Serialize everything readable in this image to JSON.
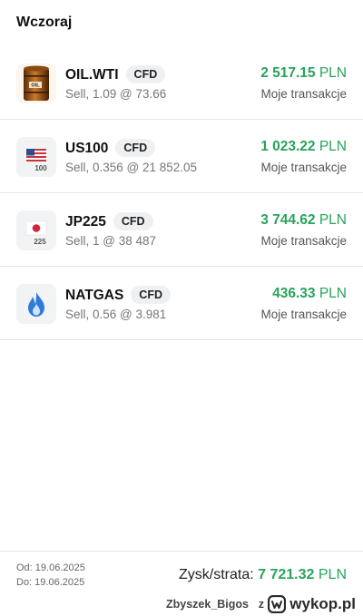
{
  "section": {
    "title": "Wczoraj"
  },
  "positions": [
    {
      "symbol": "OIL.WTI",
      "type": "CFD",
      "detail": "Sell, 1.09 @ 73.66",
      "profit_value": "2 517.15",
      "currency": "PLN",
      "link": "Moje transakcje",
      "icon": "oil-barrel-icon"
    },
    {
      "symbol": "US100",
      "type": "CFD",
      "detail": "Sell, 0.356 @ 21 852.05",
      "profit_value": "1 023.22",
      "currency": "PLN",
      "link": "Moje transakcje",
      "icon": "us-flag-icon",
      "icon_label": "100"
    },
    {
      "symbol": "JP225",
      "type": "CFD",
      "detail": "Sell, 1 @ 38 487",
      "profit_value": "3 744.62",
      "currency": "PLN",
      "link": "Moje transakcje",
      "icon": "japan-flag-icon",
      "icon_label": "225"
    },
    {
      "symbol": "NATGAS",
      "type": "CFD",
      "detail": "Sell, 0.56 @ 3.981",
      "profit_value": "436.33",
      "currency": "PLN",
      "link": "Moje transakcje",
      "icon": "gas-flame-icon"
    }
  ],
  "summary": {
    "from": "Od: 19.06.2025",
    "to": "Do: 19.06.2025",
    "pl_label": "Zysk/strata:",
    "pl_value": "7 721.32",
    "currency": "PLN"
  },
  "watermark": {
    "user": "Zbyszek_Bigos",
    "connector": "z",
    "site": "wykop.pl"
  },
  "colors": {
    "profit": "#27a35a",
    "divider": "#e6e6e6",
    "badge_bg": "#eef0f2",
    "icon_bg": "#f2f3f5"
  }
}
